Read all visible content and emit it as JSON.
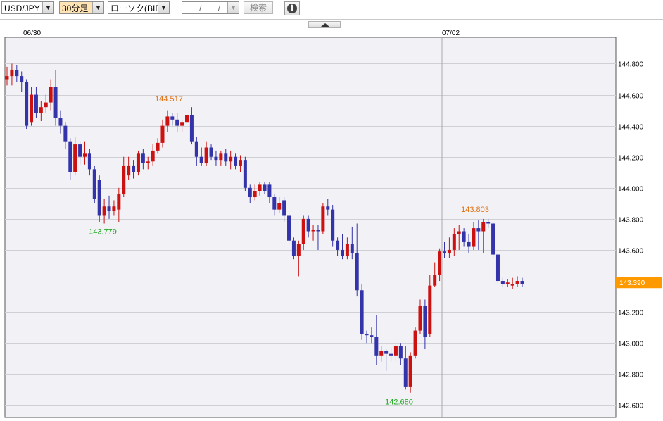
{
  "toolbar": {
    "symbol": "USD/JPY",
    "timeframe": "30分足",
    "chart_type": "ローソク(BID)",
    "date_value": "/ /",
    "search_label": "検索",
    "info_icon": "i",
    "dropdown_icon": "▼"
  },
  "colors": {
    "up": "#cc1111",
    "down": "#3333aa",
    "plot_bg": "#f2f1f5",
    "grid": "#cfcfd6",
    "price_tag_bg": "#ff9900",
    "high_label": "#e07010",
    "low_label": "#22aa22"
  },
  "chart_data": {
    "type": "candlestick",
    "instrument": "USD/JPY",
    "price_type": "BID",
    "interval": "30分足",
    "x_date_labels": [
      "06/30",
      "07/02"
    ],
    "y_ticks": [
      "142.600",
      "142.800",
      "143.000",
      "143.200",
      "143.600",
      "143.800",
      "144.000",
      "144.200",
      "144.400",
      "144.600",
      "144.800"
    ],
    "y_range": [
      142.52,
      144.97
    ],
    "current_price": "143.390",
    "annotations": [
      {
        "text": "144.517",
        "kind": "high",
        "price": 144.517
      },
      {
        "text": "143.779",
        "kind": "low",
        "price": 143.779
      },
      {
        "text": "142.680",
        "kind": "low",
        "price": 142.68
      },
      {
        "text": "143.803",
        "kind": "high",
        "price": 143.803
      }
    ],
    "candles": [
      [
        144.7,
        144.72,
        144.66,
        144.78
      ],
      [
        144.72,
        144.76,
        144.66,
        144.8
      ],
      [
        144.76,
        144.72,
        144.68,
        144.79
      ],
      [
        144.72,
        144.68,
        144.62,
        144.75
      ],
      [
        144.68,
        144.4,
        144.38,
        144.7
      ],
      [
        144.42,
        144.6,
        144.4,
        144.65
      ],
      [
        144.6,
        144.48,
        144.45,
        144.65
      ],
      [
        144.48,
        144.52,
        144.43,
        144.56
      ],
      [
        144.52,
        144.55,
        144.48,
        144.6
      ],
      [
        144.55,
        144.65,
        144.5,
        144.7
      ],
      [
        144.65,
        144.45,
        144.4,
        144.76
      ],
      [
        144.45,
        144.4,
        144.35,
        144.5
      ],
      [
        144.4,
        144.3,
        144.25,
        144.42
      ],
      [
        144.3,
        144.1,
        144.05,
        144.32
      ],
      [
        144.1,
        144.28,
        144.08,
        144.33
      ],
      [
        144.28,
        144.2,
        144.15,
        144.3
      ],
      [
        144.2,
        144.22,
        144.15,
        144.3
      ],
      [
        144.22,
        144.12,
        144.08,
        144.25
      ],
      [
        144.12,
        143.93,
        143.9,
        144.14
      ],
      [
        144.05,
        143.82,
        143.78,
        144.08
      ],
      [
        143.82,
        143.88,
        143.77,
        143.93
      ],
      [
        143.88,
        143.85,
        143.8,
        143.95
      ],
      [
        143.85,
        143.88,
        143.82,
        143.92
      ],
      [
        143.86,
        143.96,
        143.78,
        144.0
      ],
      [
        143.96,
        144.14,
        143.94,
        144.2
      ],
      [
        144.08,
        144.14,
        144.05,
        144.2
      ],
      [
        144.14,
        144.1,
        144.06,
        144.18
      ],
      [
        144.1,
        144.22,
        144.08,
        144.24
      ],
      [
        144.22,
        144.16,
        144.12,
        144.25
      ],
      [
        144.16,
        144.17,
        144.12,
        144.2
      ],
      [
        144.17,
        144.24,
        144.14,
        144.28
      ],
      [
        144.24,
        144.29,
        144.22,
        144.32
      ],
      [
        144.29,
        144.4,
        144.26,
        144.44
      ],
      [
        144.4,
        144.46,
        144.36,
        144.5
      ],
      [
        144.46,
        144.44,
        144.4,
        144.48
      ],
      [
        144.44,
        144.4,
        144.36,
        144.48
      ],
      [
        144.4,
        144.42,
        144.36,
        144.44
      ],
      [
        144.42,
        144.47,
        144.4,
        144.51
      ],
      [
        144.47,
        144.3,
        144.28,
        144.52
      ],
      [
        144.3,
        144.2,
        144.14,
        144.33
      ],
      [
        144.2,
        144.16,
        144.14,
        144.26
      ],
      [
        144.16,
        144.26,
        144.14,
        144.3
      ],
      [
        144.26,
        144.2,
        144.18,
        144.28
      ],
      [
        144.2,
        144.18,
        144.14,
        144.24
      ],
      [
        144.18,
        144.22,
        144.14,
        144.24
      ],
      [
        144.22,
        144.17,
        144.14,
        144.25
      ],
      [
        144.17,
        144.2,
        144.12,
        144.24
      ],
      [
        144.2,
        144.14,
        144.12,
        144.22
      ],
      [
        144.14,
        144.18,
        144.1,
        144.21
      ],
      [
        144.18,
        144.0,
        143.98,
        144.2
      ],
      [
        144.0,
        143.94,
        143.9,
        144.02
      ],
      [
        143.94,
        143.98,
        143.92,
        144.02
      ],
      [
        143.98,
        144.02,
        143.95,
        144.04
      ],
      [
        144.02,
        143.98,
        143.96,
        144.04
      ],
      [
        144.02,
        143.94,
        143.9,
        144.04
      ],
      [
        143.94,
        143.86,
        143.82,
        143.96
      ],
      [
        143.86,
        143.9,
        143.84,
        143.94
      ],
      [
        143.92,
        143.82,
        143.78,
        143.94
      ],
      [
        143.82,
        143.66,
        143.64,
        143.84
      ],
      [
        143.66,
        143.56,
        143.54,
        143.68
      ],
      [
        143.56,
        143.64,
        143.43,
        143.66
      ],
      [
        143.64,
        143.8,
        143.6,
        143.82
      ],
      [
        143.8,
        143.72,
        143.68,
        143.82
      ],
      [
        143.72,
        143.73,
        143.66,
        143.76
      ],
      [
        143.73,
        143.72,
        143.6,
        143.76
      ],
      [
        143.72,
        143.88,
        143.7,
        143.9
      ],
      [
        143.88,
        143.86,
        143.82,
        143.93
      ],
      [
        143.86,
        143.66,
        143.62,
        143.89
      ],
      [
        143.66,
        143.6,
        143.56,
        143.68
      ],
      [
        143.6,
        143.56,
        143.54,
        143.7
      ],
      [
        143.56,
        143.64,
        143.54,
        143.68
      ],
      [
        143.64,
        143.58,
        143.54,
        143.75
      ],
      [
        143.58,
        143.34,
        143.3,
        143.77
      ],
      [
        143.34,
        143.06,
        143.02,
        143.38
      ],
      [
        143.06,
        143.05,
        143.0,
        143.08
      ],
      [
        143.05,
        143.04,
        143.0,
        143.1
      ],
      [
        143.04,
        142.92,
        142.86,
        143.18
      ],
      [
        142.92,
        142.95,
        142.88,
        142.98
      ],
      [
        142.95,
        142.93,
        142.82,
        142.96
      ],
      [
        142.93,
        142.92,
        142.88,
        142.97
      ],
      [
        142.92,
        142.98,
        142.88,
        143.0
      ],
      [
        142.98,
        142.9,
        142.86,
        143.0
      ],
      [
        142.9,
        142.72,
        142.7,
        142.98
      ],
      [
        142.72,
        142.92,
        142.68,
        142.94
      ],
      [
        142.92,
        143.08,
        142.9,
        143.1
      ],
      [
        143.08,
        143.24,
        143.06,
        143.28
      ],
      [
        143.24,
        143.04,
        142.96,
        143.28
      ],
      [
        143.06,
        143.37,
        143.04,
        143.44
      ],
      [
        143.37,
        143.44,
        143.36,
        143.52
      ],
      [
        143.44,
        143.59,
        143.4,
        143.61
      ],
      [
        143.59,
        143.58,
        143.55,
        143.65
      ],
      [
        143.58,
        143.6,
        143.55,
        143.68
      ],
      [
        143.6,
        143.7,
        143.56,
        143.74
      ],
      [
        143.7,
        143.72,
        143.6,
        143.76
      ],
      [
        143.72,
        143.65,
        143.62,
        143.74
      ],
      [
        143.65,
        143.62,
        143.58,
        143.7
      ],
      [
        143.62,
        143.74,
        143.6,
        143.78
      ],
      [
        143.74,
        143.72,
        143.6,
        143.79
      ],
      [
        143.72,
        143.78,
        143.58,
        143.8
      ],
      [
        143.78,
        143.77,
        143.74,
        143.8
      ],
      [
        143.77,
        143.57,
        143.55,
        143.78
      ],
      [
        143.57,
        143.4,
        143.38,
        143.58
      ],
      [
        143.4,
        143.38,
        143.36,
        143.42
      ],
      [
        143.38,
        143.39,
        143.36,
        143.41
      ],
      [
        143.37,
        143.38,
        143.35,
        143.42
      ],
      [
        143.38,
        143.4,
        143.36,
        143.43
      ],
      [
        143.4,
        143.38,
        143.36,
        143.42
      ]
    ]
  }
}
